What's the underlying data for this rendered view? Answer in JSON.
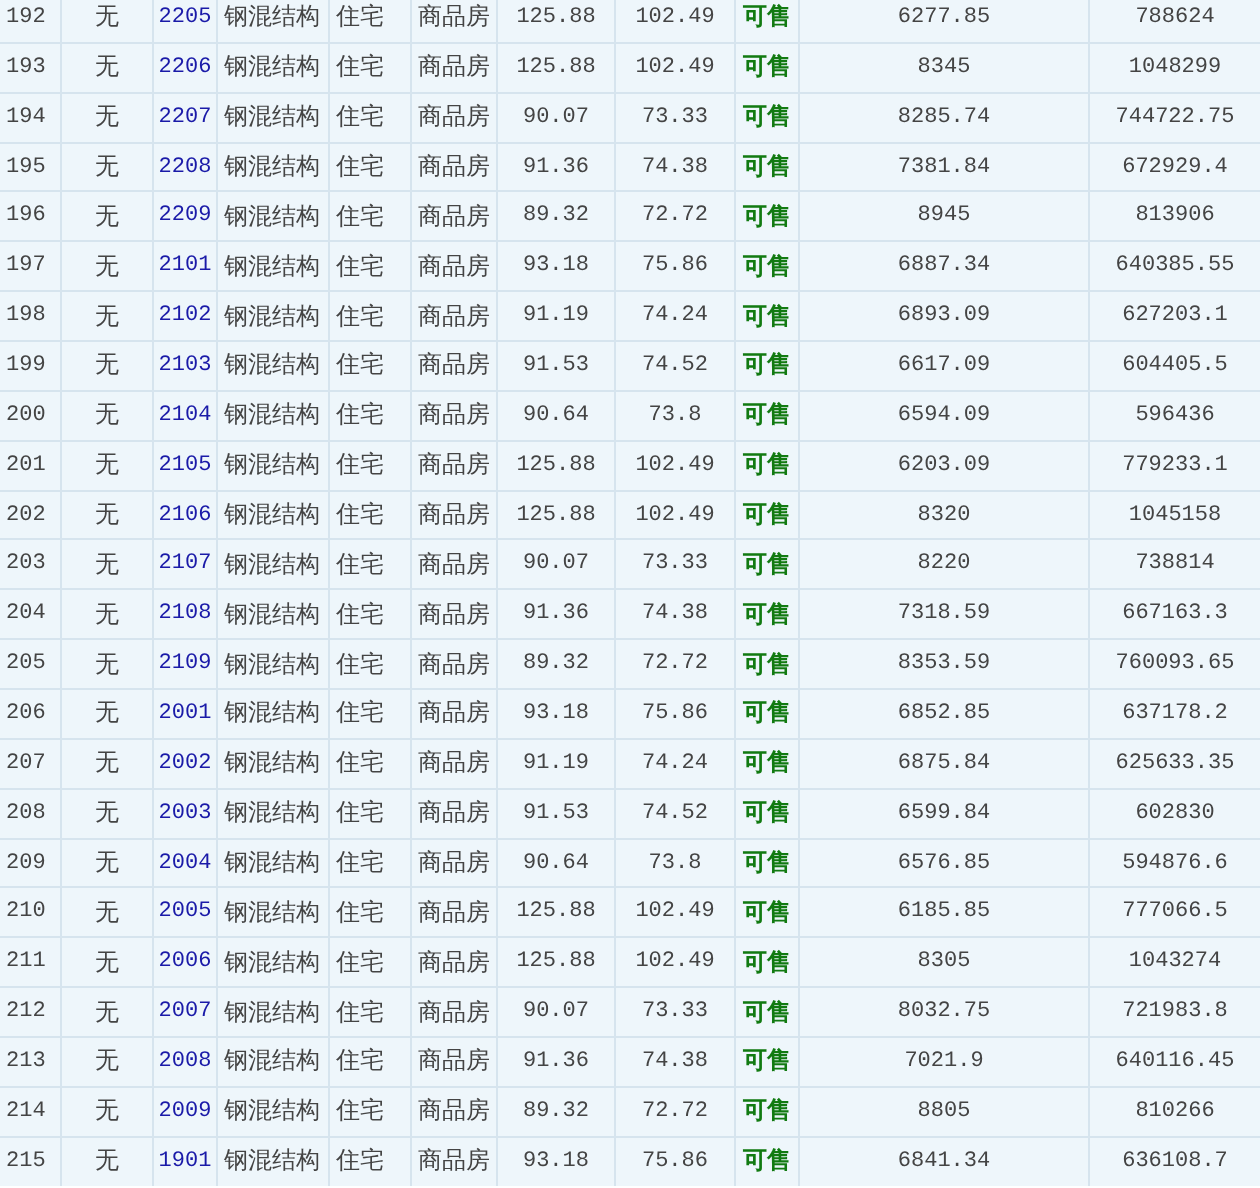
{
  "table": {
    "rows": [
      {
        "index": "192",
        "column_2": "无",
        "room": "2205",
        "structure": "钢混结构",
        "usage": "住宅",
        "property_type": "商品房",
        "column_7": "125.88",
        "column_8": "102.49",
        "status": "可售",
        "column_10": "6277.85",
        "column_11": "788624"
      },
      {
        "index": "193",
        "column_2": "无",
        "room": "2206",
        "structure": "钢混结构",
        "usage": "住宅",
        "property_type": "商品房",
        "column_7": "125.88",
        "column_8": "102.49",
        "status": "可售",
        "column_10": "8345",
        "column_11": "1048299"
      },
      {
        "index": "194",
        "column_2": "无",
        "room": "2207",
        "structure": "钢混结构",
        "usage": "住宅",
        "property_type": "商品房",
        "column_7": "90.07",
        "column_8": "73.33",
        "status": "可售",
        "column_10": "8285.74",
        "column_11": "744722.75"
      },
      {
        "index": "195",
        "column_2": "无",
        "room": "2208",
        "structure": "钢混结构",
        "usage": "住宅",
        "property_type": "商品房",
        "column_7": "91.36",
        "column_8": "74.38",
        "status": "可售",
        "column_10": "7381.84",
        "column_11": "672929.4"
      },
      {
        "index": "196",
        "column_2": "无",
        "room": "2209",
        "structure": "钢混结构",
        "usage": "住宅",
        "property_type": "商品房",
        "column_7": "89.32",
        "column_8": "72.72",
        "status": "可售",
        "column_10": "8945",
        "column_11": "813906"
      },
      {
        "index": "197",
        "column_2": "无",
        "room": "2101",
        "structure": "钢混结构",
        "usage": "住宅",
        "property_type": "商品房",
        "column_7": "93.18",
        "column_8": "75.86",
        "status": "可售",
        "column_10": "6887.34",
        "column_11": "640385.55"
      },
      {
        "index": "198",
        "column_2": "无",
        "room": "2102",
        "structure": "钢混结构",
        "usage": "住宅",
        "property_type": "商品房",
        "column_7": "91.19",
        "column_8": "74.24",
        "status": "可售",
        "column_10": "6893.09",
        "column_11": "627203.1"
      },
      {
        "index": "199",
        "column_2": "无",
        "room": "2103",
        "structure": "钢混结构",
        "usage": "住宅",
        "property_type": "商品房",
        "column_7": "91.53",
        "column_8": "74.52",
        "status": "可售",
        "column_10": "6617.09",
        "column_11": "604405.5"
      },
      {
        "index": "200",
        "column_2": "无",
        "room": "2104",
        "structure": "钢混结构",
        "usage": "住宅",
        "property_type": "商品房",
        "column_7": "90.64",
        "column_8": "73.8",
        "status": "可售",
        "column_10": "6594.09",
        "column_11": "596436"
      },
      {
        "index": "201",
        "column_2": "无",
        "room": "2105",
        "structure": "钢混结构",
        "usage": "住宅",
        "property_type": "商品房",
        "column_7": "125.88",
        "column_8": "102.49",
        "status": "可售",
        "column_10": "6203.09",
        "column_11": "779233.1"
      },
      {
        "index": "202",
        "column_2": "无",
        "room": "2106",
        "structure": "钢混结构",
        "usage": "住宅",
        "property_type": "商品房",
        "column_7": "125.88",
        "column_8": "102.49",
        "status": "可售",
        "column_10": "8320",
        "column_11": "1045158"
      },
      {
        "index": "203",
        "column_2": "无",
        "room": "2107",
        "structure": "钢混结构",
        "usage": "住宅",
        "property_type": "商品房",
        "column_7": "90.07",
        "column_8": "73.33",
        "status": "可售",
        "column_10": "8220",
        "column_11": "738814"
      },
      {
        "index": "204",
        "column_2": "无",
        "room": "2108",
        "structure": "钢混结构",
        "usage": "住宅",
        "property_type": "商品房",
        "column_7": "91.36",
        "column_8": "74.38",
        "status": "可售",
        "column_10": "7318.59",
        "column_11": "667163.3"
      },
      {
        "index": "205",
        "column_2": "无",
        "room": "2109",
        "structure": "钢混结构",
        "usage": "住宅",
        "property_type": "商品房",
        "column_7": "89.32",
        "column_8": "72.72",
        "status": "可售",
        "column_10": "8353.59",
        "column_11": "760093.65"
      },
      {
        "index": "206",
        "column_2": "无",
        "room": "2001",
        "structure": "钢混结构",
        "usage": "住宅",
        "property_type": "商品房",
        "column_7": "93.18",
        "column_8": "75.86",
        "status": "可售",
        "column_10": "6852.85",
        "column_11": "637178.2"
      },
      {
        "index": "207",
        "column_2": "无",
        "room": "2002",
        "structure": "钢混结构",
        "usage": "住宅",
        "property_type": "商品房",
        "column_7": "91.19",
        "column_8": "74.24",
        "status": "可售",
        "column_10": "6875.84",
        "column_11": "625633.35"
      },
      {
        "index": "208",
        "column_2": "无",
        "room": "2003",
        "structure": "钢混结构",
        "usage": "住宅",
        "property_type": "商品房",
        "column_7": "91.53",
        "column_8": "74.52",
        "status": "可售",
        "column_10": "6599.84",
        "column_11": "602830"
      },
      {
        "index": "209",
        "column_2": "无",
        "room": "2004",
        "structure": "钢混结构",
        "usage": "住宅",
        "property_type": "商品房",
        "column_7": "90.64",
        "column_8": "73.8",
        "status": "可售",
        "column_10": "6576.85",
        "column_11": "594876.6"
      },
      {
        "index": "210",
        "column_2": "无",
        "room": "2005",
        "structure": "钢混结构",
        "usage": "住宅",
        "property_type": "商品房",
        "column_7": "125.88",
        "column_8": "102.49",
        "status": "可售",
        "column_10": "6185.85",
        "column_11": "777066.5"
      },
      {
        "index": "211",
        "column_2": "无",
        "room": "2006",
        "structure": "钢混结构",
        "usage": "住宅",
        "property_type": "商品房",
        "column_7": "125.88",
        "column_8": "102.49",
        "status": "可售",
        "column_10": "8305",
        "column_11": "1043274"
      },
      {
        "index": "212",
        "column_2": "无",
        "room": "2007",
        "structure": "钢混结构",
        "usage": "住宅",
        "property_type": "商品房",
        "column_7": "90.07",
        "column_8": "73.33",
        "status": "可售",
        "column_10": "8032.75",
        "column_11": "721983.8"
      },
      {
        "index": "213",
        "column_2": "无",
        "room": "2008",
        "structure": "钢混结构",
        "usage": "住宅",
        "property_type": "商品房",
        "column_7": "91.36",
        "column_8": "74.38",
        "status": "可售",
        "column_10": "7021.9",
        "column_11": "640116.45"
      },
      {
        "index": "214",
        "column_2": "无",
        "room": "2009",
        "structure": "钢混结构",
        "usage": "住宅",
        "property_type": "商品房",
        "column_7": "89.32",
        "column_8": "72.72",
        "status": "可售",
        "column_10": "8805",
        "column_11": "810266"
      },
      {
        "index": "215",
        "column_2": "无",
        "room": "1901",
        "structure": "钢混结构",
        "usage": "住宅",
        "property_type": "商品房",
        "column_7": "93.18",
        "column_8": "75.86",
        "status": "可售",
        "column_10": "6841.34",
        "column_11": "636108.7"
      }
    ]
  }
}
